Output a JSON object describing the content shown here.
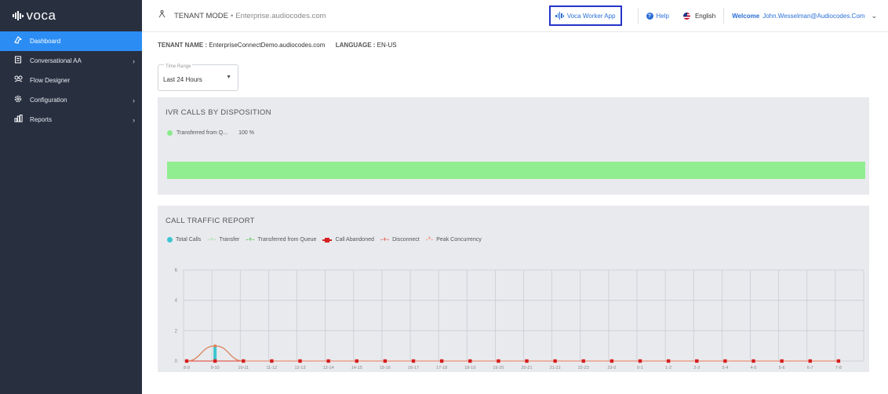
{
  "app": {
    "logo": "voca"
  },
  "sidebar": {
    "items": [
      {
        "label": "Dashboard",
        "icon": "dashboard-icon",
        "active": true,
        "expandable": false
      },
      {
        "label": "Conversational AA",
        "icon": "conversational-icon",
        "active": false,
        "expandable": true
      },
      {
        "label": "Flow Designer",
        "icon": "flow-icon",
        "active": false,
        "expandable": false
      },
      {
        "label": "Configuration",
        "icon": "gear-icon",
        "active": false,
        "expandable": true
      },
      {
        "label": "Reports",
        "icon": "reports-icon",
        "active": false,
        "expandable": true
      }
    ]
  },
  "topbar": {
    "mode_label": "TENANT MODE",
    "mode_separator": "•",
    "tenant_domain": "Enterprise.audiocodes.com",
    "voca_app_label": "Voca Worker App",
    "help_label": "Help",
    "language_label": "English",
    "welcome_label": "Welcome",
    "user_email": "John.Wesselman@Audiocodes.Com"
  },
  "info": {
    "tenant_name_label": "TENANT NAME :",
    "tenant_name_value": "EnterpriseConnectDemo.audiocodes.com",
    "language_label": "LANGUAGE :",
    "language_value": "EN-US"
  },
  "time_range": {
    "label": "Time Range",
    "value": "Last 24 Hours"
  },
  "ivr_card": {
    "title": "IVR CALLS BY DISPOSITION",
    "legend_label": "Transferred from Q...",
    "percent": "100 %"
  },
  "traffic_card": {
    "title": "CALL TRAFFIC REPORT"
  },
  "chart_data": {
    "type": "line",
    "title": "CALL TRAFFIC REPORT",
    "categories": [
      "8-9",
      "9-10",
      "10-11",
      "11-12",
      "12-13",
      "13-14",
      "14-15",
      "15-16",
      "16-17",
      "17-18",
      "18-19",
      "19-20",
      "20-21",
      "21-22",
      "22-23",
      "23-0",
      "0-1",
      "1-2",
      "2-3",
      "3-4",
      "4-5",
      "5-6",
      "6-7",
      "7-8"
    ],
    "ylim": [
      0,
      6
    ],
    "yticks": [
      "0",
      "2",
      "4",
      "6"
    ],
    "grid": true,
    "legend_position": "top-left",
    "series": [
      {
        "name": "Total Calls",
        "color": "#3cc6d0",
        "marker": "dot",
        "values": [
          0,
          1,
          0,
          0,
          0,
          0,
          0,
          0,
          0,
          0,
          0,
          0,
          0,
          0,
          0,
          0,
          0,
          0,
          0,
          0,
          0,
          0,
          0,
          0
        ]
      },
      {
        "name": "Transfer",
        "color": "#9bdc9b",
        "marker": "plus",
        "values": [
          0,
          0,
          0,
          0,
          0,
          0,
          0,
          0,
          0,
          0,
          0,
          0,
          0,
          0,
          0,
          0,
          0,
          0,
          0,
          0,
          0,
          0,
          0,
          0
        ]
      },
      {
        "name": "Transferred from Queue",
        "color": "#35b935",
        "marker": "plus",
        "values": [
          0,
          1,
          0,
          0,
          0,
          0,
          0,
          0,
          0,
          0,
          0,
          0,
          0,
          0,
          0,
          0,
          0,
          0,
          0,
          0,
          0,
          0,
          0,
          0
        ]
      },
      {
        "name": "Call Abandoned",
        "color": "#d42020",
        "marker": "square",
        "values": [
          0,
          0,
          0,
          0,
          0,
          0,
          0,
          0,
          0,
          0,
          0,
          0,
          0,
          0,
          0,
          0,
          0,
          0,
          0,
          0,
          0,
          0,
          0,
          0
        ]
      },
      {
        "name": "Disconnect",
        "color": "#e03a2a",
        "marker": "plus",
        "values": [
          0,
          0,
          0,
          0,
          0,
          0,
          0,
          0,
          0,
          0,
          0,
          0,
          0,
          0,
          0,
          0,
          0,
          0,
          0,
          0,
          0,
          0,
          0,
          0
        ]
      },
      {
        "name": "Peak Concurrency",
        "color": "#f07a5c",
        "marker": "star",
        "values": [
          0,
          1,
          0,
          0,
          0,
          0,
          0,
          0,
          0,
          0,
          0,
          0,
          0,
          0,
          0,
          0,
          0,
          0,
          0,
          0,
          0,
          0,
          0,
          0
        ]
      }
    ]
  }
}
